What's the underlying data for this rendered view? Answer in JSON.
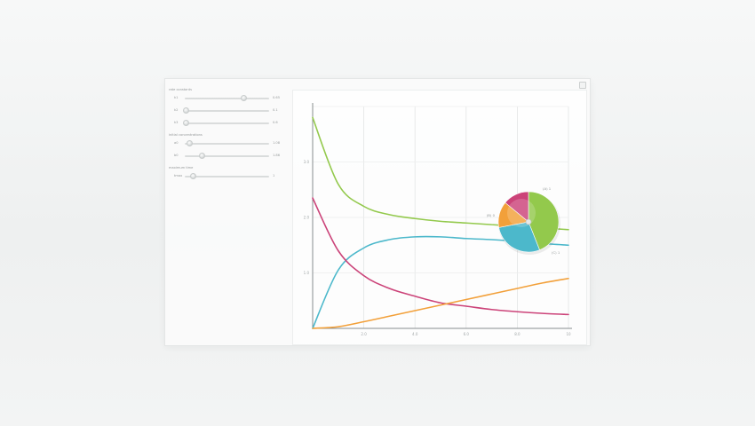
{
  "window": {
    "title": ""
  },
  "controls": {
    "sections": [
      {
        "title": "rate constants",
        "sliders": [
          {
            "label": "k1",
            "value_text": "0.65",
            "fraction": 0.7
          },
          {
            "label": "k2",
            "value_text": "0.1",
            "fraction": 0.02
          },
          {
            "label": "k3",
            "value_text": "0.6",
            "fraction": 0.02
          }
        ]
      },
      {
        "title": "initial concentrations",
        "sliders": [
          {
            "label": "a0",
            "value_text": "1.08",
            "fraction": 0.06
          },
          {
            "label": "b0",
            "value_text": "1.86",
            "fraction": 0.21
          }
        ]
      },
      {
        "title": "maximum time",
        "sliders": [
          {
            "label": "tmax",
            "value_text": "1",
            "fraction": 0.1
          }
        ]
      }
    ]
  },
  "chart_data": {
    "type": "line",
    "x": [
      0,
      1,
      2,
      3,
      4,
      5,
      6,
      7,
      8,
      9,
      10
    ],
    "xlim": [
      0,
      10
    ],
    "ylim": [
      0,
      4
    ],
    "xticks": [
      "",
      "2.0",
      "4.0",
      "6.0",
      "8.0",
      "10"
    ],
    "yticks": [
      "",
      "1.0",
      "2.0",
      "3.0",
      ""
    ],
    "grid": true,
    "series": [
      {
        "color": "#8cc63f",
        "values": [
          3.8,
          2.6,
          2.2,
          2.05,
          1.98,
          1.93,
          1.9,
          1.87,
          1.84,
          1.81,
          1.78
        ]
      },
      {
        "color": "#3fb4c8",
        "values": [
          0.0,
          1.05,
          1.45,
          1.6,
          1.65,
          1.65,
          1.62,
          1.6,
          1.57,
          1.53,
          1.5
        ]
      },
      {
        "color": "#c9356f",
        "values": [
          2.35,
          1.4,
          0.95,
          0.72,
          0.58,
          0.46,
          0.4,
          0.34,
          0.3,
          0.27,
          0.25
        ]
      },
      {
        "color": "#f39a2b",
        "values": [
          0.0,
          0.03,
          0.12,
          0.22,
          0.32,
          0.42,
          0.52,
          0.62,
          0.72,
          0.82,
          0.9
        ]
      }
    ],
    "pie": {
      "slices": [
        {
          "color": "#8cc63f",
          "value": 44
        },
        {
          "color": "#3fb4c8",
          "value": 28
        },
        {
          "color": "#f39a2b",
          "value": 14
        },
        {
          "color": "#c9356f",
          "value": 14
        }
      ],
      "labels": [
        "(A) 1",
        "(B) 0",
        "(C) 1"
      ]
    }
  }
}
